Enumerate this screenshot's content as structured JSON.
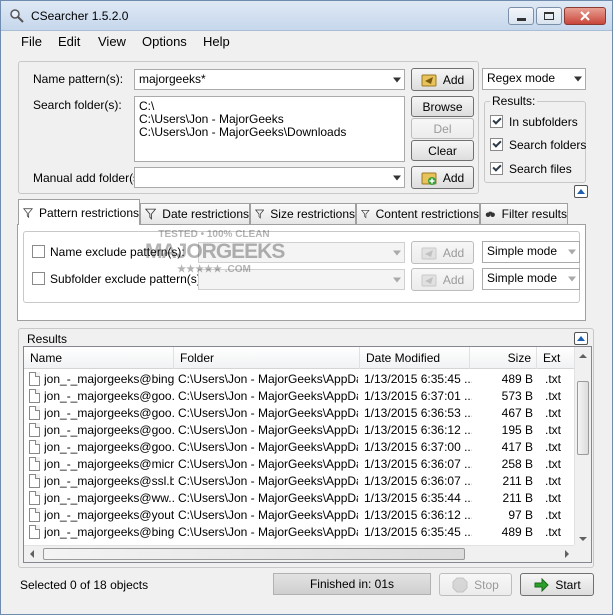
{
  "window": {
    "title": "CSearcher 1.5.2.0"
  },
  "menu": [
    "File",
    "Edit",
    "View",
    "Options",
    "Help"
  ],
  "search": {
    "name_pattern_label": "Name pattern(s):",
    "name_pattern_value": "majorgeeks*",
    "name_add_label": "Add",
    "mode_value": "Regex mode",
    "search_folder_label": "Search folder(s):",
    "folders": [
      "C:\\",
      "C:\\Users\\Jon - MajorGeeks",
      "C:\\Users\\Jon - MajorGeeks\\Downloads"
    ],
    "browse_label": "Browse",
    "del_label": "Del",
    "clear_label": "Clear",
    "manual_add_label": "Manual add folder(s):",
    "manual_add_value": "",
    "manual_add_button": "Add"
  },
  "results_options": {
    "title": "Results:",
    "items": [
      {
        "label": "In subfolders",
        "checked": true
      },
      {
        "label": "Search folders",
        "checked": true
      },
      {
        "label": "Search files",
        "checked": true
      }
    ]
  },
  "tabs": [
    "Pattern restrictions",
    "Date restrictions",
    "Size restrictions",
    "Content restrictions",
    "Filter results"
  ],
  "pattern_restrictions": {
    "rows": [
      {
        "label": "Name exclude pattern(s):",
        "checked": false,
        "value": "",
        "add_label": "Add",
        "mode": "Simple mode"
      },
      {
        "label": "Subfolder exclude pattern(s):",
        "checked": false,
        "value": "",
        "add_label": "Add",
        "mode": "Simple mode"
      }
    ]
  },
  "watermark": {
    "line1": "TESTED • 100% CLEAN",
    "line2": "MAJORGEEKS",
    "line3": "★★★★★ .COM"
  },
  "results": {
    "title": "Results",
    "columns": [
      "Name",
      "Folder",
      "Date Modified",
      "Size",
      "Ext"
    ],
    "rows": [
      [
        "jon_-_majorgeeks@bing[...",
        "C:\\Users\\Jon - MajorGeeks\\AppDa...",
        "1/13/2015 6:35:45 ...",
        "489 B",
        ".txt"
      ],
      [
        "jon_-_majorgeeks@goo...",
        "C:\\Users\\Jon - MajorGeeks\\AppDa...",
        "1/13/2015 6:37:01 ...",
        "573 B",
        ".txt"
      ],
      [
        "jon_-_majorgeeks@goo...",
        "C:\\Users\\Jon - MajorGeeks\\AppDa...",
        "1/13/2015 6:36:53 ...",
        "467 B",
        ".txt"
      ],
      [
        "jon_-_majorgeeks@goo...",
        "C:\\Users\\Jon - MajorGeeks\\AppDa...",
        "1/13/2015 6:36:12 ...",
        "195 B",
        ".txt"
      ],
      [
        "jon_-_majorgeeks@goo...",
        "C:\\Users\\Jon - MajorGeeks\\AppDa...",
        "1/13/2015 6:37:00 ...",
        "417 B",
        ".txt"
      ],
      [
        "jon_-_majorgeeks@micr...",
        "C:\\Users\\Jon - MajorGeeks\\AppDa...",
        "1/13/2015 6:36:07 ...",
        "258 B",
        ".txt"
      ],
      [
        "jon_-_majorgeeks@ssl.bi...",
        "C:\\Users\\Jon - MajorGeeks\\AppDa...",
        "1/13/2015 6:36:07 ...",
        "211 B",
        ".txt"
      ],
      [
        "jon_-_majorgeeks@ww...",
        "C:\\Users\\Jon - MajorGeeks\\AppDa...",
        "1/13/2015 6:35:44 ...",
        "211 B",
        ".txt"
      ],
      [
        "jon_-_majorgeeks@yout...",
        "C:\\Users\\Jon - MajorGeeks\\AppDa...",
        "1/13/2015 6:36:12 ...",
        "97 B",
        ".txt"
      ],
      [
        "jon_-_majorgeeks@bing[...",
        "C:\\Users\\Jon - MajorGeeks\\AppDa...",
        "1/13/2015 6:35:45 ...",
        "489 B",
        ".txt"
      ]
    ]
  },
  "status": {
    "selection_text": "Selected 0 of 18 objects",
    "progress_text": "Finished in: 01s",
    "progress_fraction": 1.0,
    "stop_label": "Stop",
    "start_label": "Start"
  },
  "colors": {
    "accent": "#1e5fb0",
    "start_arrow": "#2aa02a",
    "add_icon": "#e8c25a"
  }
}
